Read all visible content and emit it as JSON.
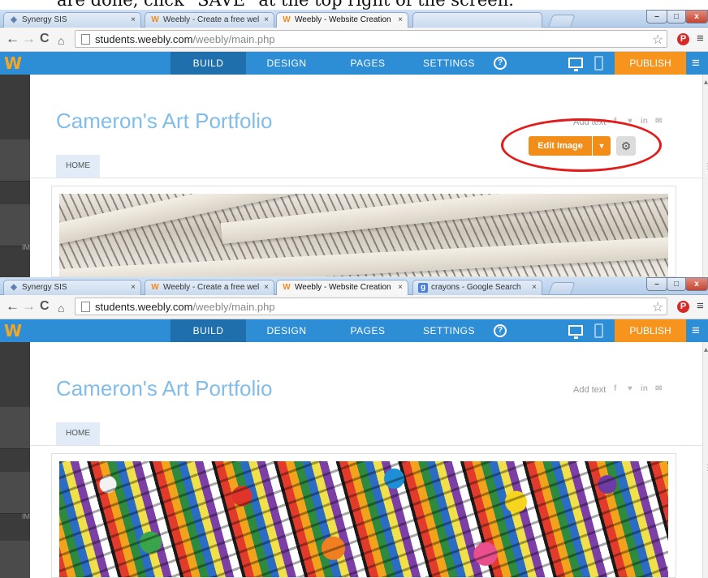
{
  "instruction": {
    "text": "are done, click \"SAVE\" at the top right of the screen."
  },
  "shots": [
    {
      "tabs": [
        {
          "label": "Synergy SIS"
        },
        {
          "label": "Weebly - Create a free wel"
        },
        {
          "label": "Weebly - Website Creation"
        }
      ],
      "address": {
        "host": "students.weebly.com",
        "path": "/weebly/main.php"
      },
      "nav": {
        "logo": "W",
        "build": "BUILD",
        "design": "DESIGN",
        "pages": "PAGES",
        "settings": "SETTINGS",
        "help": "?",
        "publish": "PUBLISH"
      },
      "site": {
        "title": "Cameron's Art Portfolio",
        "add_text": "Add text",
        "home": "HOME"
      },
      "rail_label": "IM",
      "edit_toolbar": {
        "edit_label": "Edit Image"
      },
      "image": "wooden roof beams"
    },
    {
      "tabs": [
        {
          "label": "Synergy SIS"
        },
        {
          "label": "Weebly - Create a free wel"
        },
        {
          "label": "Weebly - Website Creation"
        },
        {
          "label": "crayons - Google Search"
        }
      ],
      "address": {
        "host": "students.weebly.com",
        "path": "/weebly/main.php"
      },
      "nav": {
        "logo": "W",
        "build": "BUILD",
        "design": "DESIGN",
        "pages": "PAGES",
        "settings": "SETTINGS",
        "help": "?",
        "publish": "PUBLISH"
      },
      "site": {
        "title": "Cameron's Art Portfolio",
        "add_text": "Add text",
        "home": "HOME"
      },
      "rail_label": "IM",
      "image": "crayons"
    }
  ],
  "icons": {
    "social": [
      "facebook-icon",
      "twitter-icon",
      "linkedin-icon",
      "email-icon"
    ],
    "close": "close-icon",
    "gear": "gear-icon"
  },
  "colors": {
    "weebly_blue": "#2d8dd5",
    "active_nav": "#1f6fad",
    "publish_orange": "#f7941d",
    "title_blue": "#81bde8",
    "highlight_red": "#e21b1b"
  }
}
